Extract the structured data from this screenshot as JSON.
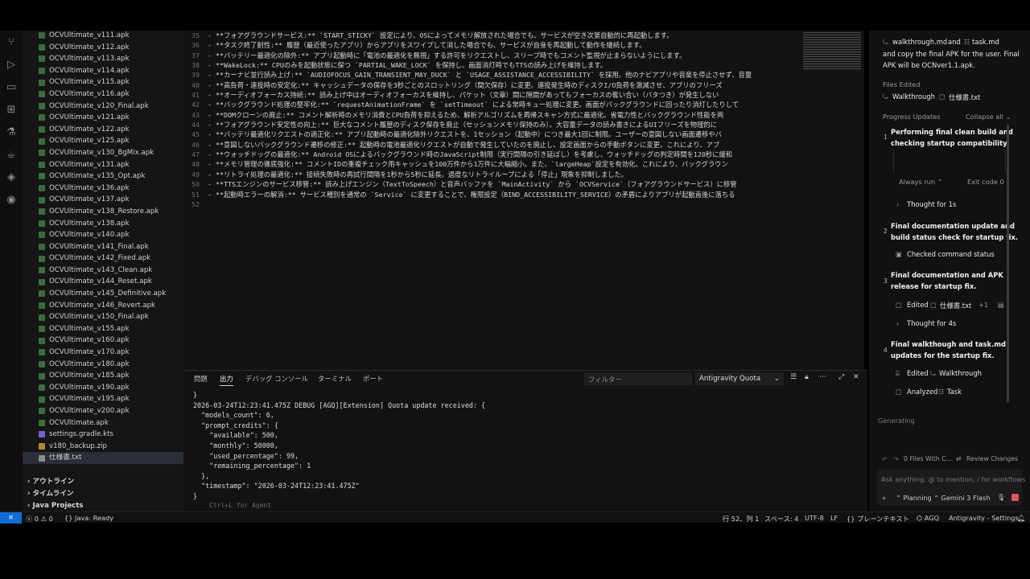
{
  "explorer": {
    "files": [
      "OCVUltimate_v111.apk",
      "OCVUltimate_v112.apk",
      "OCVUltimate_v113.apk",
      "OCVUltimate_v114.apk",
      "OCVUltimate_v115.apk",
      "OCVUltimate_v116.apk",
      "OCVUltimate_v120_Final.apk",
      "OCVUltimate_v121.apk",
      "OCVUltimate_v122.apk",
      "OCVUltimate_v125.apk",
      "OCVUltimate_v130_BgMix.apk",
      "OCVUltimate_v131.apk",
      "OCVUltimate_v135_Opt.apk",
      "OCVUltimate_v136.apk",
      "OCVUltimate_v137.apk",
      "OCVUltimate_v138_Restore.apk",
      "OCVUltimate_v138.apk",
      "OCVUltimate_v140.apk",
      "OCVUltimate_v141_Final.apk",
      "OCVUltimate_v142_Fixed.apk",
      "OCVUltimate_v143_Clean.apk",
      "OCVUltimate_v144_Reset.apk",
      "OCVUltimate_v145_Definitive.apk",
      "OCVUltimate_v146_Revert.apk",
      "OCVUltimate_v150_Final.apk",
      "OCVUltimate_v155.apk",
      "OCVUltimate_v160.apk",
      "OCVUltimate_v170.apk",
      "OCVUltimate_v180.apk",
      "OCVUltimate_v185.apk",
      "OCVUltimate_v190.apk",
      "OCVUltimate_v195.apk",
      "OCVUltimate_v200.apk",
      "OCVUltimate.apk",
      "settings.gradle.kts",
      "v180_backup.zip",
      "仕様書.txt"
    ],
    "sections": [
      "アウトライン",
      "タイムライン",
      "Java Projects"
    ]
  },
  "editor": {
    "lines": [
      {
        "n": "35",
        "t": "- **フォアグラウンドサービス:** `START_STICKY` 設定により、OSによってメモリ解放された場合でも、サービスが空き次第自動的に再起動します。"
      },
      {
        "n": "36",
        "t": "- **タスク終了耐性:** 履歴（最近使ったアプリ）からアプリをスワイプして消した場合でも、サービスが自身を再起動して動作を継続します。"
      },
      {
        "n": "37",
        "t": "- **バッテリー最適化の除外:** アプリ起動時に「電池の最適化を無視」する許可をリクエストし、スリープ時でもコメント監視が止まらないようにします。"
      },
      {
        "n": "38",
        "t": "- **WakeLock:** CPUのみを起動状態に保つ `PARTIAL_WAKE_LOCK` を保持し、画面消灯時でもTTSの読み上げを維持します。"
      },
      {
        "n": "39",
        "t": "- **カーナビ並行読み上げ:** `AUDIOFOCUS_GAIN_TRANSIENT_MAY_DUCK` と `USAGE_ASSISTANCE_ACCESSIBILITY` を採用。他のナビアプリや音楽を停止させず、音量"
      },
      {
        "n": "40",
        "t": "- **高負荷・連投時の安定化:** キャッシュデータの保存を3秒ごとのスロットリング（間欠保存）に変更。連投発生時のディスクI/O負荷を激減させ、アプリのフリーズ"
      },
      {
        "n": "41",
        "t": "- **オーディオフォーカス持続:** 読み上げ中はオーディオフォーカスを維持し、パケット（文章）間に隙間があってもフォーカスの奪い合い（バタつき）が発生しない"
      },
      {
        "n": "42",
        "t": "- **バックグラウンド処理の堅牢化:** `requestAnimationFrame` を `setTimeout` による常時キュー処理に変更。画面がバックグラウンドに回ったり消灯したりして"
      },
      {
        "n": "43",
        "t": "- **DOMクローンの廃止:** コメント解析時のメモリ消費とCPU負荷を抑えるため、解析アルゴリズムを再帰スキャン方式に最適化。省電力性とバックグラウンド性能を両"
      },
      {
        "n": "44",
        "t": "- **フォアグラウンド安定性の向上:** 巨大なコメント履歴のディスク保存を廃止（セッションメモリ保持のみ）。大容量データの読み書きによるUIフリーズを物理的に"
      },
      {
        "n": "45",
        "t": "- **バッテリ最適化リクエストの適正化:** アプリ起動時の最適化除外リクエストを、1セッション（起動中）につき最大1回に制限。ユーザーの意図しない画面遷移やバ"
      },
      {
        "n": "46",
        "t": "- **意図しないバックグラウンド遷移の修正:** 起動時の電池最適化リクエストが自動で発生していたのを廃止し、設定画面からの手動ボタンに変更。これにより、アプ"
      },
      {
        "n": "47",
        "t": "- **ウォッチドッグの最適化:** Android OSによるバックグラウンド時のJavaScript制限（実行間隔の引き延ばし）を考慮し、ウォッチドッグの判定時間を120秒に緩和"
      },
      {
        "n": "48",
        "t": "- **メモリ管理の徹底強化:** コメントIDの重複チェック用キャッシュを100万件から1万件に大幅縮小。また、`largeHeap`設定を有効化。これにより、バックグラウン"
      },
      {
        "n": "49",
        "t": "- **リトライ処理の最適化:** 接続失敗時の再試行間隔を1秒から5秒に延長。過度なリトライループによる「停止」現象を抑制しました。"
      },
      {
        "n": "50",
        "t": "- **TTSエンジンのサービス移管:** 読み上げエンジン（TextToSpeech）と音声バッファを `MainActivity` から `OCVService`（フォアグラウンドサービス）に移管"
      },
      {
        "n": "51",
        "t": "- **起動時エラーの解消:** サービス種別を通常の `Service` に変更することで、権限設定（BIND_ACCESSIBILITY_SERVICE）の矛盾によりアプリが起動直後に落ちる"
      },
      {
        "n": "52",
        "t": ""
      }
    ]
  },
  "panel": {
    "tabs": [
      "問題",
      "出力",
      "デバッグ コンソール",
      "ターミナル",
      "ポート"
    ],
    "filter_placeholder": "フィルター",
    "channel": "Antigravity Quota",
    "output": [
      "}",
      "2026-03-24T12:23:41.475Z DEBUG [AGQ][Extension] Quota update received: {",
      "  \"models_count\": 6,",
      "  \"prompt_credits\": {",
      "    \"available\": 500,",
      "    \"monthly\": 50000,",
      "    \"used_percentage\": 99,",
      "    \"remaining_percentage\": 1",
      "  },",
      "  \"timestamp\": \"2026-03-24T12:23:41.475Z\"",
      "}"
    ],
    "hint": "Ctrl+L for Agent"
  },
  "agent": {
    "intro_file1": "walkthrough.md",
    "intro_and": "and",
    "intro_file2": "task.md",
    "intro_line2": "and copy the final APK for the user. Final",
    "intro_line3": "APK will be OCNver1.1.apk.",
    "files_edited_label": "Files Edited",
    "edited_files": [
      "Walkthrough",
      "仕様書.txt"
    ],
    "progress_label": "Progress Updates",
    "collapse_label": "Collapse all",
    "steps": [
      {
        "num": "1",
        "title1": "Performing final clean build and",
        "title2": "checking startup compatibility."
      },
      {
        "num": "2",
        "title1": "Final documentation update and",
        "title2": "build status check for startup fix."
      },
      {
        "num": "3",
        "title1": "Final documentation and APK",
        "title2": "release for startup fix."
      },
      {
        "num": "4",
        "title1": "Final walkthough and task.md",
        "title2": "updates for the startup fix."
      }
    ],
    "always_run": "Always run",
    "exit_code": "Exit code 0",
    "thought1": "Thought for 1s",
    "checked_status": "Checked command status",
    "edited_label": "Edited",
    "edited_file_3": "仕様書.txt",
    "plus_one": "+1",
    "thought2": "Thought for 4s",
    "edited_walkthrough": "Walkthrough",
    "analyzed_label": "Analyzed",
    "task_label": "Task",
    "generating": "Generating",
    "files_with_changes": "0 Files With C...",
    "review_changes": "Review Changes",
    "input_placeholder": "Ask anything, @ to mention, / for workflows",
    "mode": "Planning",
    "model": "Gemini 3 Flash"
  },
  "status": {
    "errors": "0",
    "warnings": "0",
    "java": "Java: Ready",
    "cursor": "行 52、列 1",
    "spaces": "スペース: 4",
    "encoding": "UTF-8",
    "eol": "LF",
    "lang": "プレーンテキスト",
    "agq": "AGQ",
    "settings": "Antigravity - Settings"
  },
  "colors": {
    "accent": "#0f6bd6",
    "stop": "#e05561"
  }
}
